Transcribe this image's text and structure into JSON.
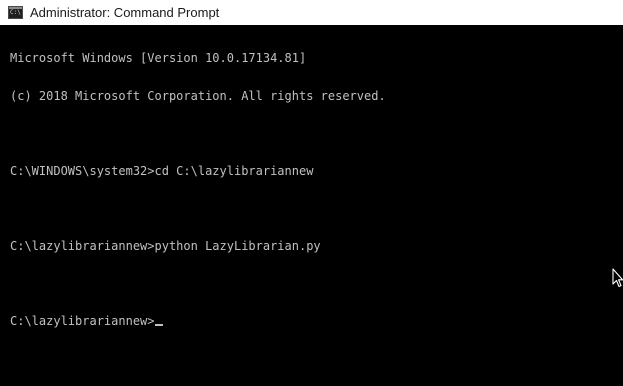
{
  "window": {
    "title": "Administrator: Command Prompt",
    "icon": "cmd-icon",
    "icon_glyph": "C:\\"
  },
  "console": {
    "lines": [
      "Microsoft Windows [Version 10.0.17134.81]",
      "(c) 2018 Microsoft Corporation. All rights reserved.",
      "",
      "C:\\WINDOWS\\system32>cd C:\\lazylibrariannew",
      "",
      "C:\\lazylibrariannew>python LazyLibrarian.py",
      "",
      "C:\\lazylibrariannew>"
    ],
    "text_color": "#c0c0c0",
    "background_color": "#000000"
  },
  "pointer": {
    "icon": "mouse-pointer-icon"
  }
}
